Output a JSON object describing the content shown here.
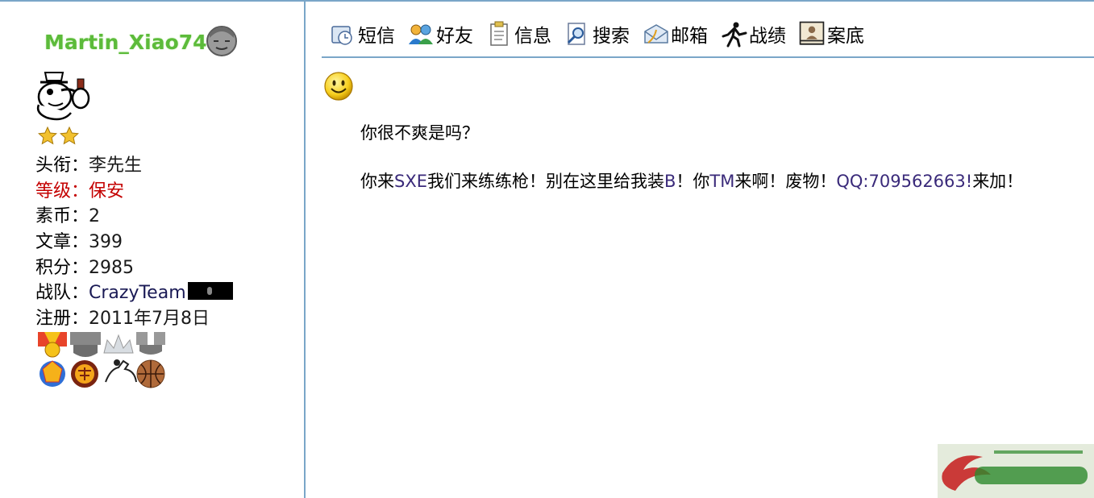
{
  "profile": {
    "username": "Martin_Xiao74",
    "info_rows": [
      {
        "label": "头衔：",
        "value": "李先生"
      },
      {
        "label": "等级：",
        "value": "保安"
      },
      {
        "label": "素币：",
        "value": "2"
      },
      {
        "label": "文章：",
        "value": "399"
      },
      {
        "label": "积分：",
        "value": "2985"
      },
      {
        "label": "战队：",
        "value": "CrazyTeam"
      },
      {
        "label": "注册：",
        "value": "2011年7月8日"
      }
    ],
    "rank_star_count": 2,
    "medal_icons": [
      "medal-ribbon-icon",
      "medal-shield-icon",
      "medal-crown-icon",
      "medal-grey-ribbon-icon",
      "medal-wine-icon",
      "medal-money-icon",
      "medal-horse-icon",
      "medal-basketball-icon"
    ]
  },
  "toolbar": {
    "items": [
      {
        "label": "短信",
        "icon": "sms-icon"
      },
      {
        "label": "好友",
        "icon": "friends-icon"
      },
      {
        "label": "信息",
        "icon": "info-icon"
      },
      {
        "label": "搜索",
        "icon": "search-icon"
      },
      {
        "label": "邮箱",
        "icon": "mail-icon"
      },
      {
        "label": "战绩",
        "icon": "record-icon"
      },
      {
        "label": "案底",
        "icon": "case-record-icon"
      }
    ]
  },
  "message": {
    "line1": "你很不爽是吗？",
    "line2_parts": [
      "你来",
      "SXE",
      "我们来练练枪！别在这里给我装",
      "B",
      "！你",
      "TM",
      "来啊！废物！",
      "QQ:709562663!",
      "来加！"
    ]
  },
  "colors": {
    "border_blue": "#7aa6c8",
    "username_green": "#5cbb3a",
    "level_red": "#c40000"
  }
}
